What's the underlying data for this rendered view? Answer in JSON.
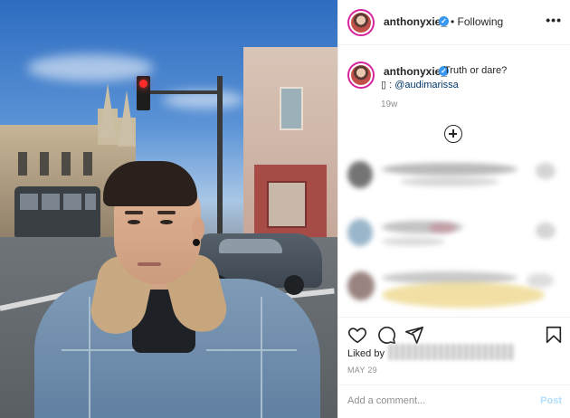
{
  "post": {
    "author": "anthonyxie_",
    "follow_state": "• Following",
    "more_glyph": "•••"
  },
  "caption": {
    "author": "anthonyxie_",
    "text": "Truth or dare?",
    "tag_prefix": "▯ :",
    "mention": "@audimarissa",
    "time_ago": "19w"
  },
  "engagement": {
    "liked_by_label": "Liked by",
    "date": "MAY 29"
  },
  "composer": {
    "placeholder": "Add a comment...",
    "post_label": "Post"
  },
  "colors": {
    "verified": "#3897f0",
    "story_ring": "#d6249f",
    "post_disabled": "#b2dffc",
    "mention": "#00376b"
  },
  "icons": {
    "like": "heart-icon",
    "comment": "comment-bubble-icon",
    "share": "paper-plane-icon",
    "save": "bookmark-icon",
    "load_more": "plus-circle-icon"
  }
}
